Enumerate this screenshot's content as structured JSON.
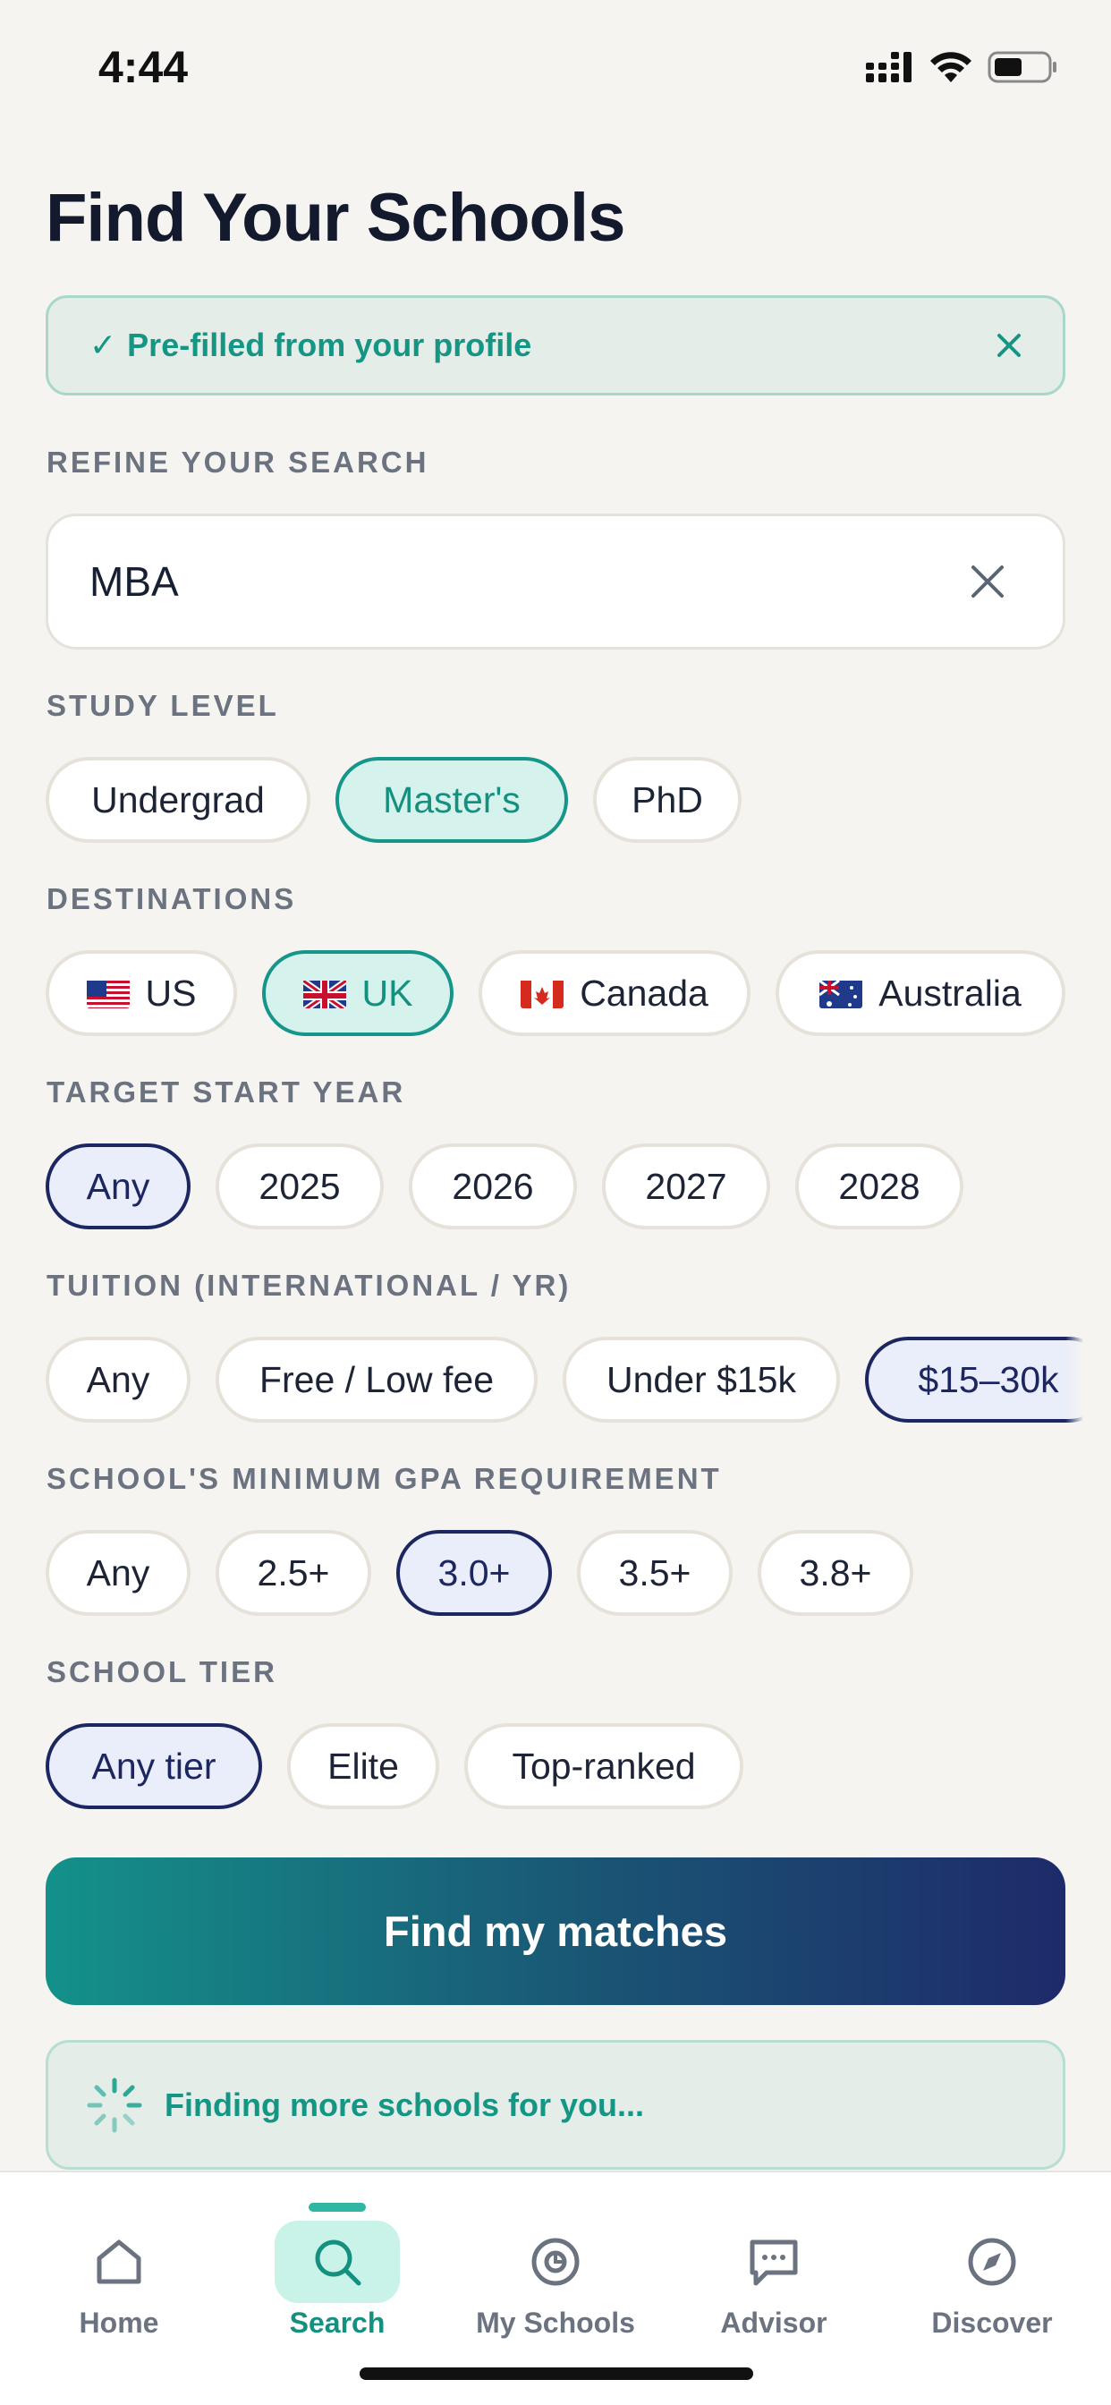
{
  "status": {
    "time": "4:44"
  },
  "page": {
    "title": "Find Your Schools"
  },
  "banner": {
    "check": "✓",
    "text": "Pre-filled from your profile"
  },
  "refine": {
    "label": "REFINE YOUR SEARCH",
    "value": "MBA"
  },
  "study_level": {
    "label": "STUDY LEVEL",
    "options": [
      "Undergrad",
      "Master's",
      "PhD"
    ],
    "selected": "Master's"
  },
  "destinations": {
    "label": "DESTINATIONS",
    "options": [
      "US",
      "UK",
      "Canada",
      "Australia"
    ],
    "selected": "UK"
  },
  "start_year": {
    "label": "TARGET START YEAR",
    "options": [
      "Any",
      "2025",
      "2026",
      "2027",
      "2028"
    ],
    "selected": "Any"
  },
  "tuition": {
    "label": "TUITION (INTERNATIONAL / YR)",
    "options": [
      "Any",
      "Free / Low fee",
      "Under $15k",
      "$15–30k"
    ],
    "selected": "$15–30k"
  },
  "gpa": {
    "label": "SCHOOL'S MINIMUM GPA REQUIREMENT",
    "options": [
      "Any",
      "2.5+",
      "3.0+",
      "3.5+",
      "3.8+"
    ],
    "selected": "3.0+"
  },
  "tier": {
    "label": "SCHOOL TIER",
    "options": [
      "Any tier",
      "Elite",
      "Top-ranked"
    ],
    "selected": "Any tier"
  },
  "cta": {
    "label": "Find my matches"
  },
  "loading": {
    "text": "Finding more schools for you..."
  },
  "tabs": [
    {
      "label": "Home",
      "icon": "home-icon"
    },
    {
      "label": "Search",
      "icon": "search-icon",
      "active": true
    },
    {
      "label": "My Schools",
      "icon": "target-icon"
    },
    {
      "label": "Advisor",
      "icon": "chat-icon"
    },
    {
      "label": "Discover",
      "icon": "compass-icon"
    }
  ],
  "colors": {
    "background": "#f5f4f0",
    "teal": "#16968a",
    "navy": "#1c2762",
    "gradient_start": "#14918a",
    "gradient_end": "#1e2a6a"
  }
}
